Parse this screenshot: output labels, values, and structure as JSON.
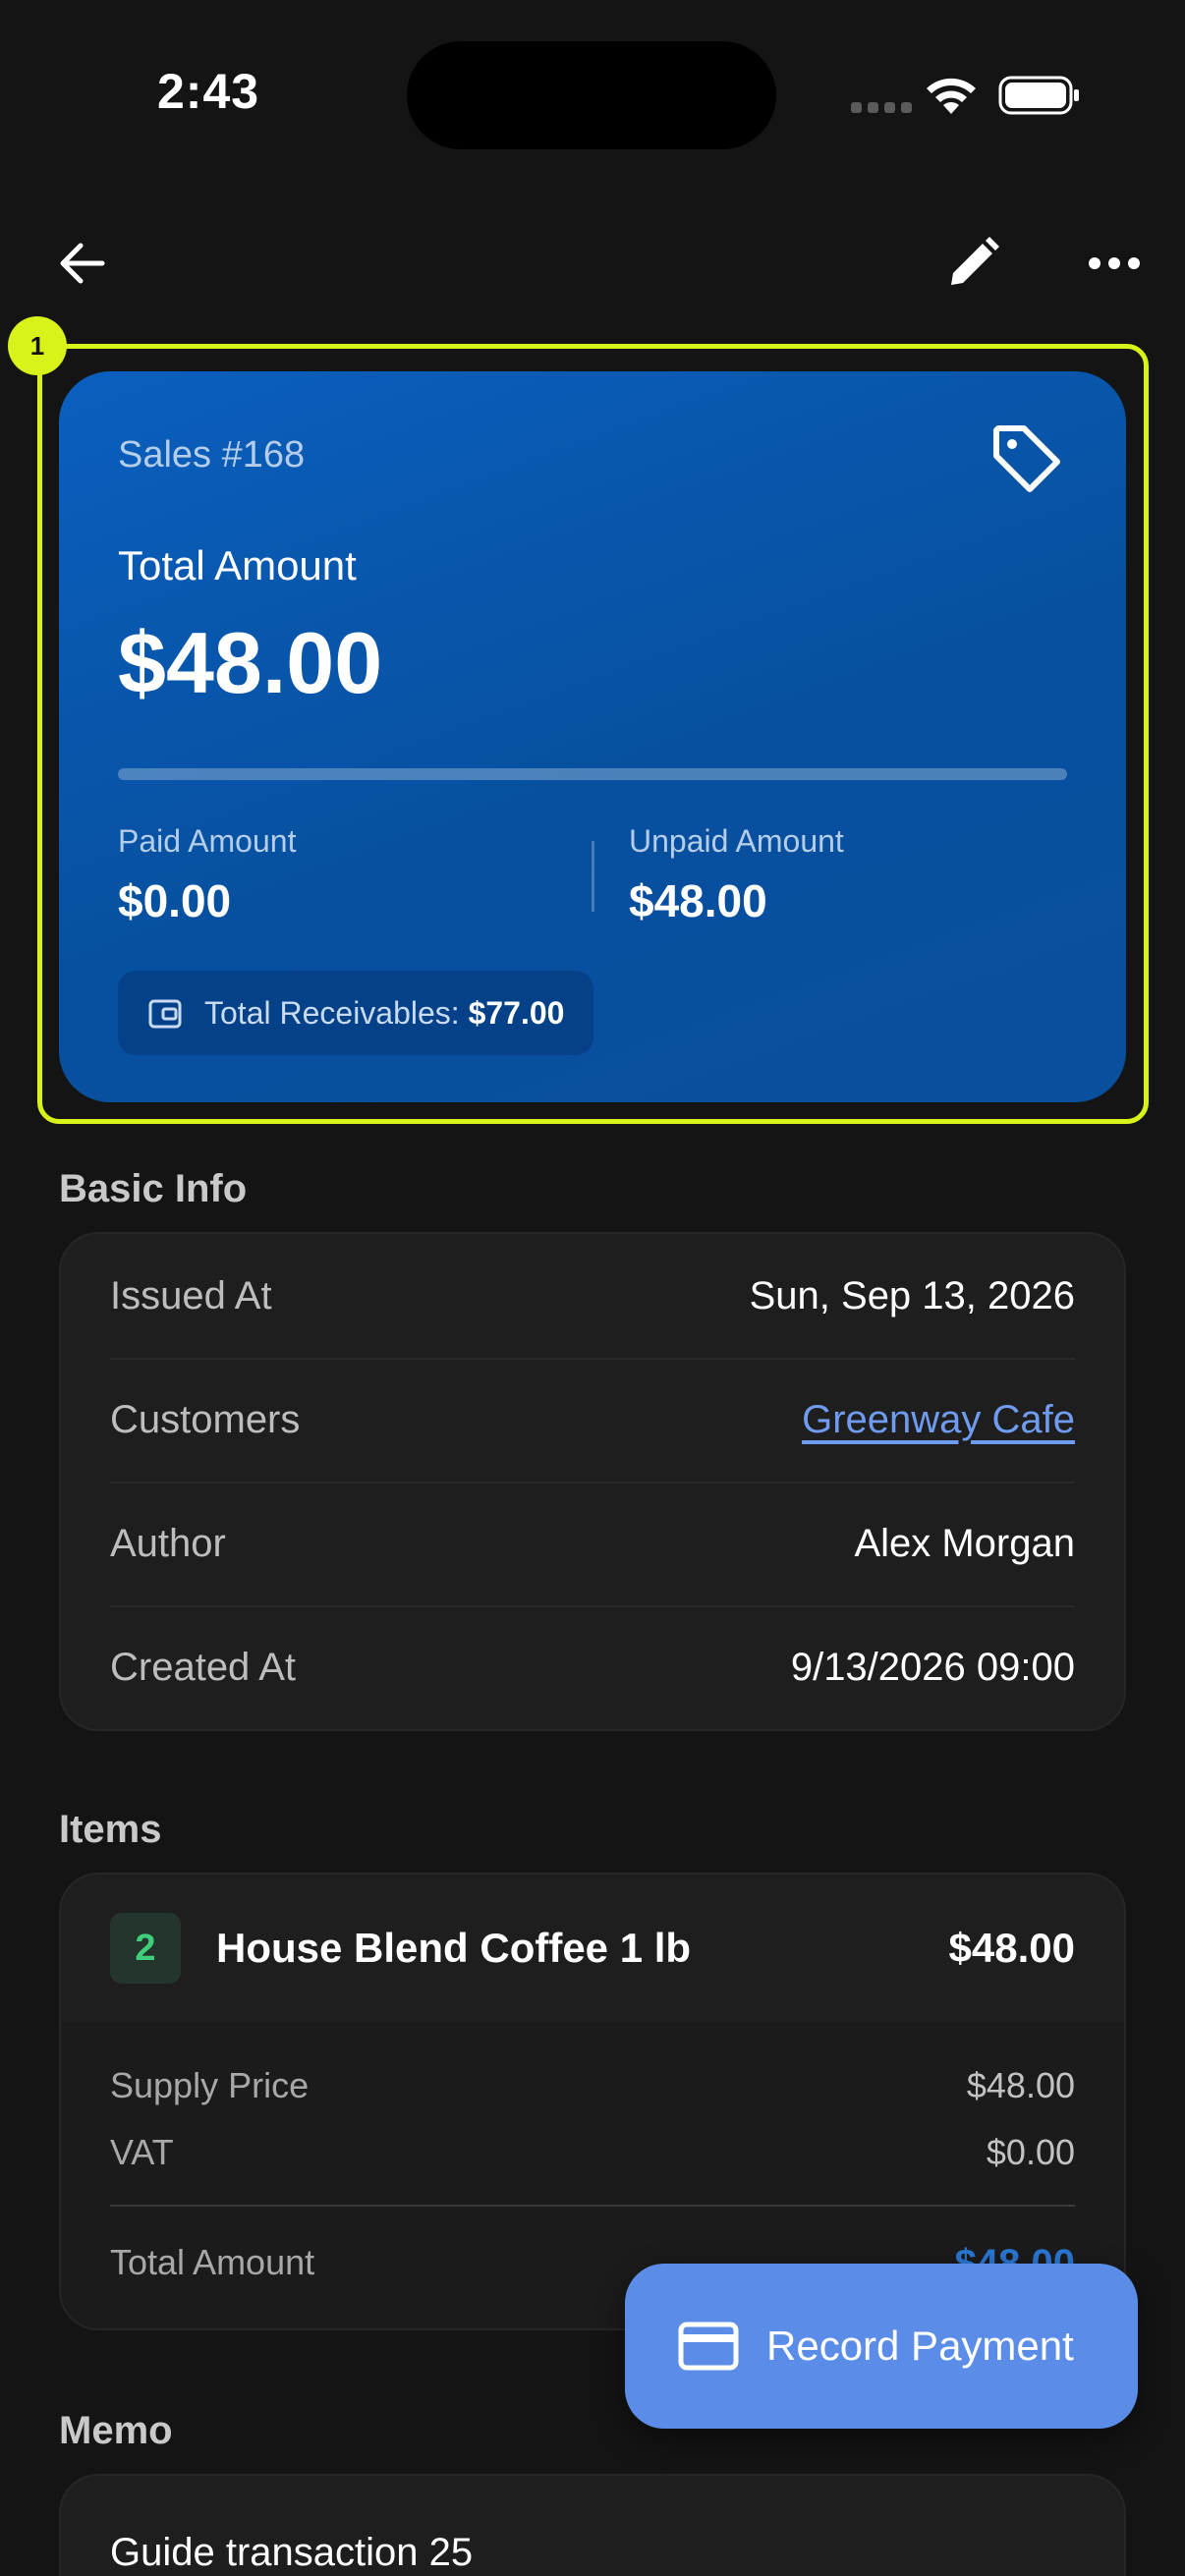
{
  "status_bar": {
    "time": "2:43"
  },
  "hero": {
    "sales_label": "Sales #168",
    "total_label": "Total Amount",
    "total_value": "$48.00",
    "paid_fraction": 0,
    "paid_label": "Paid Amount",
    "paid_value": "$0.00",
    "unpaid_label": "Unpaid Amount",
    "unpaid_value": "$48.00",
    "receivables_label": "Total Receivables:",
    "receivables_value": "$77.00"
  },
  "highlight_badge": "1",
  "basic_info": {
    "title": "Basic Info",
    "rows": [
      {
        "label": "Issued At",
        "value": "Sun, Sep 13, 2026"
      },
      {
        "label": "Customers",
        "value": "Greenway Cafe"
      },
      {
        "label": "Author",
        "value": "Alex Morgan"
      },
      {
        "label": "Created At",
        "value": "9/13/2026 09:00"
      }
    ]
  },
  "items": {
    "title": "Items",
    "list": [
      {
        "qty": "2",
        "name": "House Blend Coffee 1 lb",
        "price": "$48.00",
        "supply_price_label": "Supply Price",
        "supply_price": "$48.00",
        "vat_label": "VAT",
        "vat": "$0.00",
        "total_label": "Total Amount",
        "total": "$48.00"
      }
    ]
  },
  "fab": {
    "label": "Record Payment"
  },
  "memo": {
    "title": "Memo",
    "text": "Guide transaction 25"
  },
  "colors": {
    "accent": "#5b8de8",
    "hero": "#0a5fbe",
    "highlight": "#d8f31a",
    "link": "#6f9cf0",
    "qty": "#3fce7a"
  }
}
